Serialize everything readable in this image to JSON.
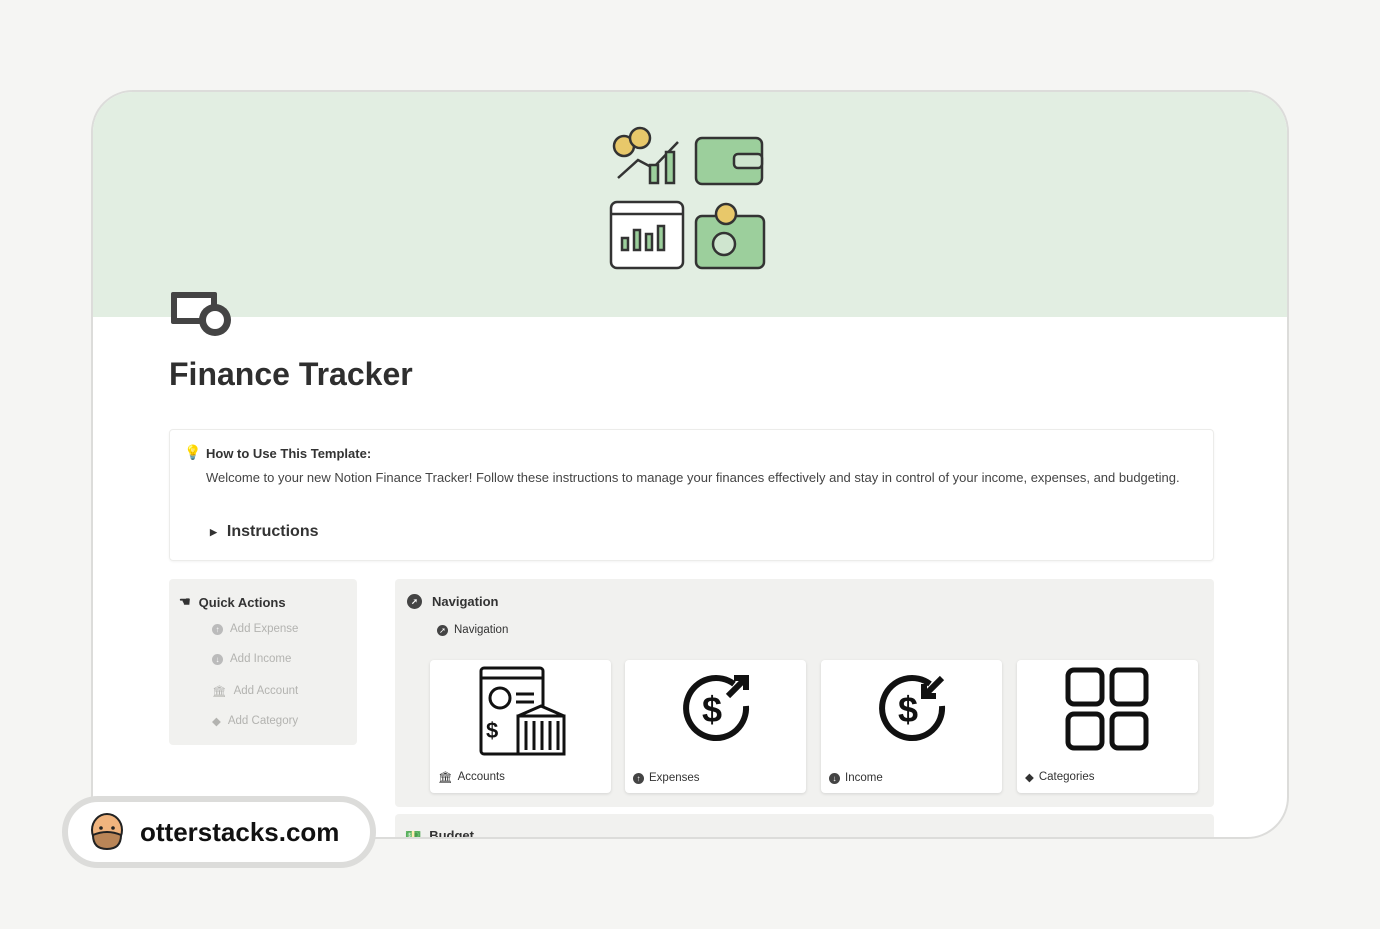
{
  "page": {
    "title": "Finance Tracker"
  },
  "callout": {
    "heading": "How to Use This Template:",
    "body": "Welcome to your new Notion Finance Tracker! Follow these instructions to manage your finances effectively and stay in control of your income, expenses, and budgeting.",
    "toggle": "Instructions"
  },
  "quick_actions": {
    "title": "Quick Actions",
    "items": [
      {
        "label": "Add Expense"
      },
      {
        "label": "Add Income"
      },
      {
        "label": "Add Account"
      },
      {
        "label": "Add Category"
      }
    ]
  },
  "navigation": {
    "title": "Navigation",
    "subtitle": "Navigation",
    "cards": [
      {
        "label": "Accounts",
        "icon": "bank-icon"
      },
      {
        "label": "Expenses",
        "icon": "dollar-out-icon"
      },
      {
        "label": "Income",
        "icon": "dollar-in-icon"
      },
      {
        "label": "Categories",
        "icon": "grid-icon"
      }
    ]
  },
  "budget": {
    "title": "Budget"
  },
  "watermark": {
    "text": "otterstacks.com"
  },
  "colors": {
    "cover": "#e2eee2",
    "panel": "#f1f1ef"
  }
}
